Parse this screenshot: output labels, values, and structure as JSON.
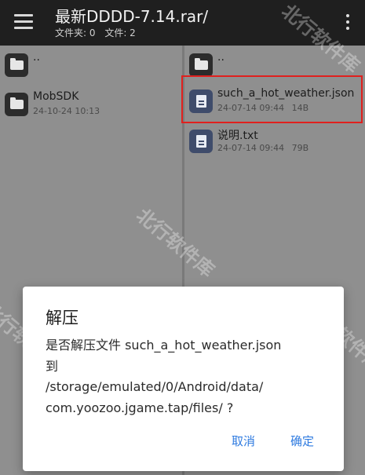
{
  "header": {
    "title": "最新DDDD-7.14.rar/",
    "folders_label": "文件夹: 0",
    "files_label": "文件: 2",
    "menu_icon": "hamburger-menu-icon",
    "more_icon": "more-vert-icon"
  },
  "left_pane": {
    "items": [
      {
        "name": "..",
        "meta": "",
        "icon": "folder-icon"
      },
      {
        "name": "MobSDK",
        "meta": "24-10-24 10:13",
        "icon": "folder-icon"
      }
    ]
  },
  "right_pane": {
    "items": [
      {
        "name": "..",
        "date": "",
        "size": "",
        "icon": "folder-icon"
      },
      {
        "name": "such_a_hot_weather.json",
        "date": "24-07-14 09:44",
        "size": "14B",
        "icon": "document-icon",
        "highlighted": true
      },
      {
        "name": "说明.txt",
        "date": "24-07-14 09:44",
        "size": "79B",
        "icon": "document-icon"
      }
    ]
  },
  "dialog": {
    "title": "解压",
    "message_lines": [
      "是否解压文件 such_a_hot_weather.json",
      "到",
      "/storage/emulated/0/Android/data/",
      "com.yoozoo.jgame.tap/files/ ?"
    ],
    "cancel_label": "取消",
    "ok_label": "确定"
  },
  "watermark": "北行软件库",
  "colors": {
    "accent": "#2f7be0",
    "highlight_border": "#e0201e",
    "top_bar": "#1f1f1f"
  }
}
